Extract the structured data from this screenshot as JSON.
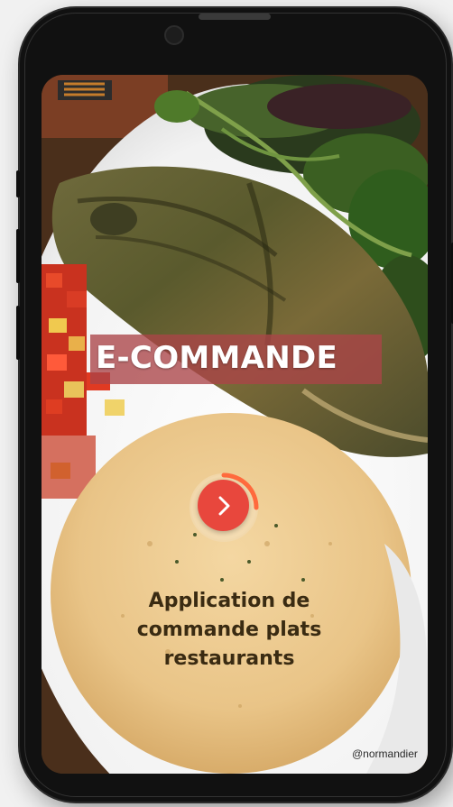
{
  "screen": {
    "title": "E-COMMANDE",
    "subtitle": "Application de commande plats restaurants",
    "photo_credit": "@normandier",
    "start_button_icon": "chevron-right-icon",
    "start_button_color": "#e8473d",
    "title_band_color": "#ab4448",
    "subtitle_color": "#3a2b12",
    "background_photo": "grilled fish with salad, diced vegetables and couscous on a white plate"
  }
}
